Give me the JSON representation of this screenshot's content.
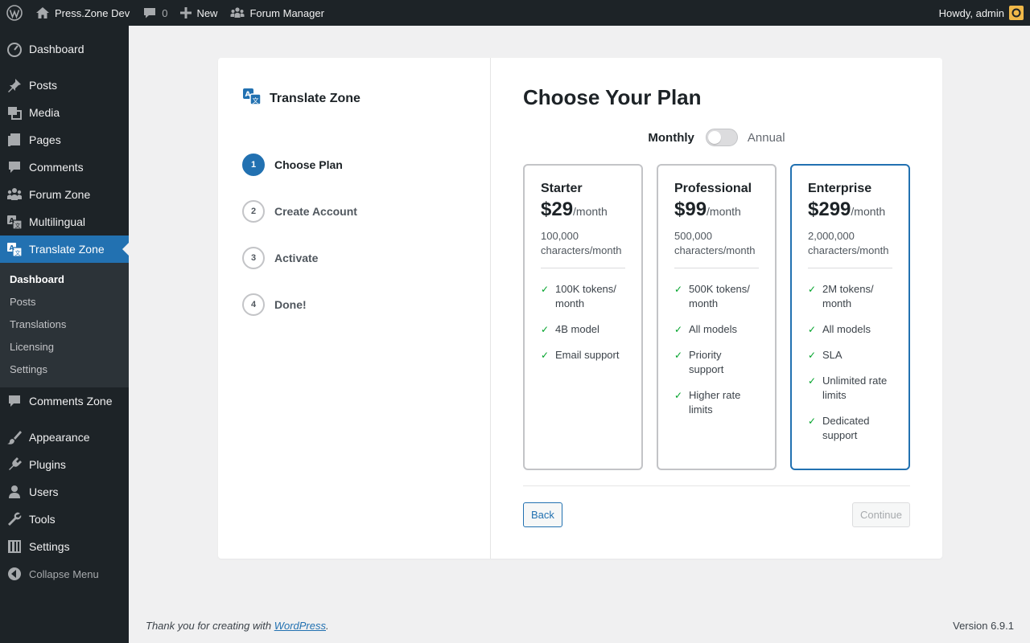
{
  "adminbar": {
    "site_name": "Press.Zone Dev",
    "comments_count": "0",
    "new_label": "New",
    "forum_manager_label": "Forum Manager",
    "howdy": "Howdy, admin"
  },
  "sidebar": {
    "items": [
      {
        "label": "Dashboard",
        "icon": "dashboard-icon"
      },
      {
        "label": "Posts",
        "icon": "pin-icon"
      },
      {
        "label": "Media",
        "icon": "media-icon"
      },
      {
        "label": "Pages",
        "icon": "pages-icon"
      },
      {
        "label": "Comments",
        "icon": "comment-icon"
      },
      {
        "label": "Forum Zone",
        "icon": "groups-icon"
      },
      {
        "label": "Multilingual",
        "icon": "translate-icon"
      },
      {
        "label": "Translate Zone",
        "icon": "translate-icon"
      },
      {
        "label": "Comments Zone",
        "icon": "comment-icon"
      },
      {
        "label": "Appearance",
        "icon": "brush-icon"
      },
      {
        "label": "Plugins",
        "icon": "plugin-icon"
      },
      {
        "label": "Users",
        "icon": "user-icon"
      },
      {
        "label": "Tools",
        "icon": "wrench-icon"
      },
      {
        "label": "Settings",
        "icon": "settings-icon"
      },
      {
        "label": "Collapse Menu",
        "icon": "collapse-icon"
      }
    ],
    "submenu": [
      "Dashboard",
      "Posts",
      "Translations",
      "Licensing",
      "Settings"
    ]
  },
  "wizard": {
    "brand": "Translate Zone",
    "steps": [
      {
        "num": "1",
        "label": "Choose Plan"
      },
      {
        "num": "2",
        "label": "Create Account"
      },
      {
        "num": "3",
        "label": "Activate"
      },
      {
        "num": "4",
        "label": "Done!"
      }
    ],
    "title": "Choose Your Plan",
    "billing": {
      "monthly": "Monthly",
      "annual": "Annual"
    },
    "plans": [
      {
        "name": "Starter",
        "price": "$29",
        "period": "/month",
        "chars": "100,000 characters/month",
        "features": [
          "100K tokens/ month",
          "4B model",
          "Email support"
        ]
      },
      {
        "name": "Professional",
        "price": "$99",
        "period": "/month",
        "chars": "500,000 characters/month",
        "features": [
          "500K tokens/ month",
          "All models",
          "Priority support",
          "Higher rate limits"
        ]
      },
      {
        "name": "Enterprise",
        "price": "$299",
        "period": "/month",
        "chars": "2,000,000 characters/month",
        "features": [
          "2M tokens/ month",
          "All models",
          "SLA",
          "Unlimited rate limits",
          "Dedicated support"
        ]
      }
    ],
    "back_label": "Back",
    "continue_label": "Continue"
  },
  "footer": {
    "thanks_prefix": "Thank you for creating with ",
    "wordpress_link": "WordPress",
    "thanks_suffix": ".",
    "version": "Version 6.9.1"
  }
}
